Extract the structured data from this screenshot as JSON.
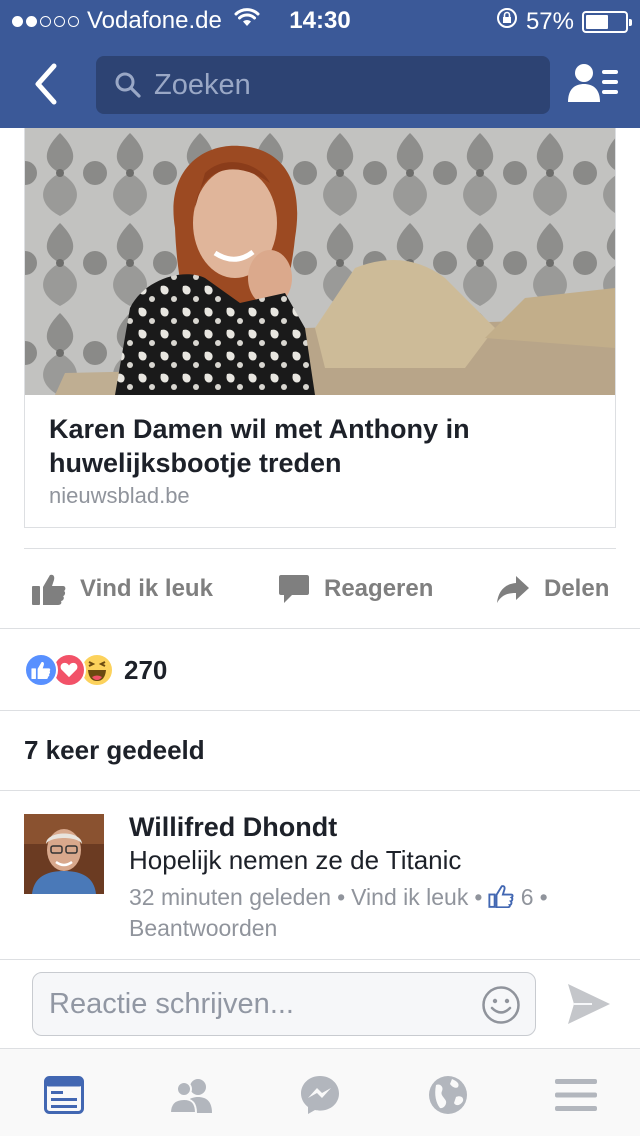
{
  "status_bar": {
    "carrier": "Vodafone.de",
    "time": "14:30",
    "battery": "57%",
    "battery_level": 0.57,
    "signal_bars_filled": 2,
    "signal_bars_total": 5
  },
  "nav": {
    "search_placeholder": "Zoeken"
  },
  "post": {
    "link_title": "Karen Damen wil met Anthony in huwelijksbootje treden",
    "link_domain": "nieuwsblad.be"
  },
  "actions": {
    "like": "Vind ik leuk",
    "comment": "Reageren",
    "share": "Delen"
  },
  "reactions": {
    "types": [
      "like",
      "love",
      "haha"
    ],
    "count": "270"
  },
  "shares": "7 keer gedeeld",
  "comment": {
    "author": "Willifred Dhondt",
    "text": "Hopelijk nemen ze de Titanic",
    "time": "32 minuten geleden",
    "like_link": "Vind ik leuk",
    "like_count": "6",
    "reply_link": "Beantwoorden"
  },
  "compose": {
    "placeholder": "Reactie schrijven..."
  },
  "tabs": [
    "news-feed",
    "friend-requests",
    "messenger",
    "notifications",
    "more"
  ],
  "colors": {
    "brand": "#3b5998",
    "active_tab": "#4267b2",
    "inactive_tab": "#b2b6bd"
  }
}
